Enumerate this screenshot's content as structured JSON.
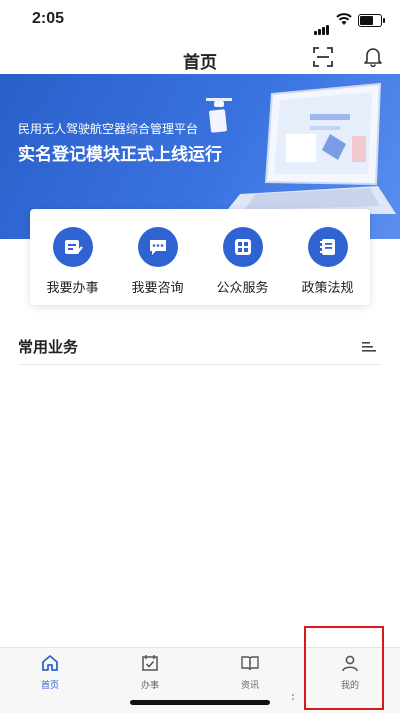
{
  "status_bar": {
    "time": "2:05"
  },
  "nav": {
    "title": "首页",
    "scan_icon": "scan-icon",
    "bell_icon": "bell-icon"
  },
  "banner": {
    "line1": "民用无人驾驶航空器综合管理平台",
    "line2": "实名登记模块正式上线运行"
  },
  "quick_actions": [
    {
      "label": "我要办事",
      "icon": "edit-document-icon"
    },
    {
      "label": "我要咨询",
      "icon": "chat-bubble-icon"
    },
    {
      "label": "公众服务",
      "icon": "grid-apps-icon"
    },
    {
      "label": "政策法规",
      "icon": "policy-book-icon"
    }
  ],
  "section": {
    "title": "常用业务",
    "menu_icon": "list-menu-icon"
  },
  "tabs": [
    {
      "label": "首页",
      "icon": "home-icon",
      "active": true
    },
    {
      "label": "办事",
      "icon": "calendar-check-icon",
      "active": false
    },
    {
      "label": "资讯",
      "icon": "book-icon",
      "active": false
    },
    {
      "label": "我的",
      "icon": "user-icon",
      "active": false
    }
  ],
  "colors": {
    "brand": "#2f63d1",
    "banner": "#3a73e0",
    "highlight": "#d6191c"
  }
}
